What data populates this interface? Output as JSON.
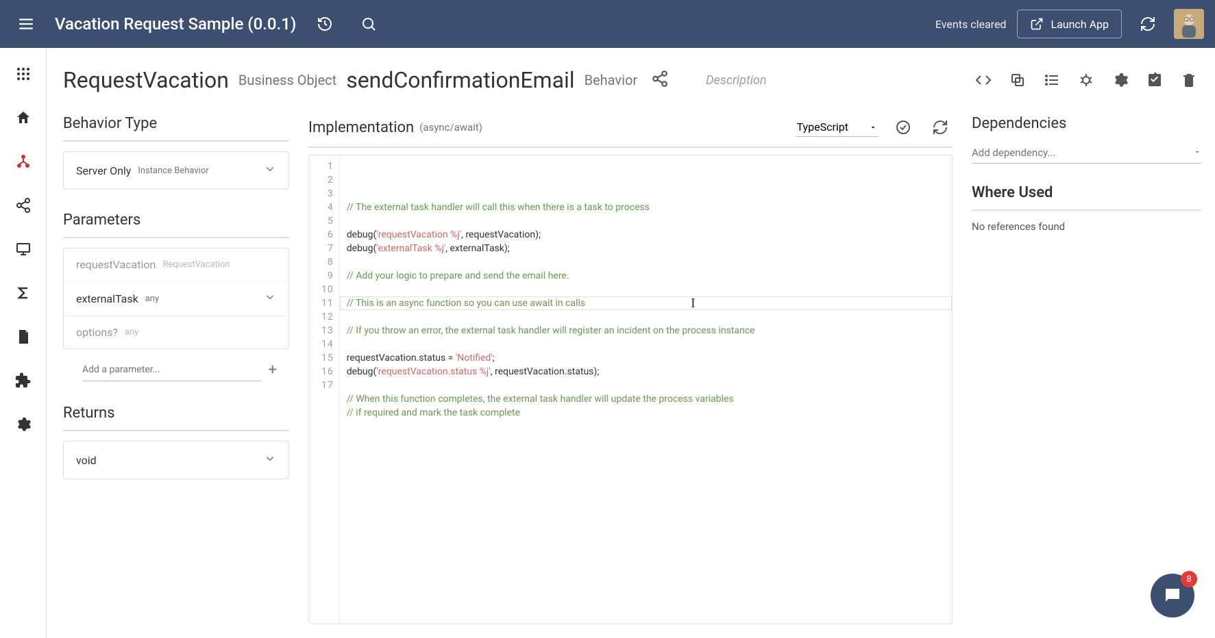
{
  "app": {
    "title": "Vacation Request Sample (0.0.1)",
    "events": "Events cleared",
    "launch": "Launch App"
  },
  "breadcrumb": {
    "entity": "RequestVacation",
    "entityType": "Business Object",
    "behavior": "sendConfirmationEmail",
    "behaviorType": "Behavior",
    "description": "Description"
  },
  "left": {
    "behaviorTypeTitle": "Behavior Type",
    "behaviorType": "Server Only",
    "behaviorTypeSub": "Instance Behavior",
    "parametersTitle": "Parameters",
    "params": [
      {
        "name": "requestVacation",
        "type": "RequestVacation",
        "dim": true,
        "expandable": false
      },
      {
        "name": "externalTask",
        "type": "any",
        "dim": false,
        "expandable": true
      },
      {
        "name": "options?",
        "type": "any",
        "dim": true,
        "expandable": false
      }
    ],
    "addParam": "Add a parameter...",
    "returnsTitle": "Returns",
    "returnsValue": "void"
  },
  "editor": {
    "title": "Implementation",
    "subtitle": "(async/await)",
    "language": "TypeScript",
    "lines": [
      {
        "n": 1,
        "plain": "// The external task handler will call this when there is a task to process",
        "cls": "c"
      },
      {
        "n": 2,
        "plain": "",
        "cls": ""
      },
      {
        "n": 3,
        "pre": "debug(",
        "str": "'requestVacation %j'",
        "post": ", requestVacation);"
      },
      {
        "n": 4,
        "pre": "debug(",
        "str": "'externalTask %j'",
        "post": ", externalTask);"
      },
      {
        "n": 5,
        "plain": "",
        "cls": ""
      },
      {
        "n": 6,
        "plain": "// Add your logic to prepare and send the email here.",
        "cls": "c"
      },
      {
        "n": 7,
        "plain": "",
        "cls": ""
      },
      {
        "n": 8,
        "plain": "// This is an async function so you can use await in calls",
        "cls": "c"
      },
      {
        "n": 9,
        "plain": "",
        "cls": ""
      },
      {
        "n": 10,
        "plain": "// If you throw an error, the external task handler will register an incident on the process instance",
        "cls": "c"
      },
      {
        "n": 11,
        "plain": "",
        "cls": ""
      },
      {
        "n": 12,
        "pre": "requestVacation.status = ",
        "str": "'Notified'",
        "post": ";"
      },
      {
        "n": 13,
        "pre": "debug(",
        "str": "'requestVacation.status %j'",
        "post": ", requestVacation.status);"
      },
      {
        "n": 14,
        "plain": "",
        "cls": ""
      },
      {
        "n": 15,
        "plain": "// When this function completes, the external task handler will update the process variables",
        "cls": "c"
      },
      {
        "n": 16,
        "plain": "// if required and mark the task complete",
        "cls": "c"
      },
      {
        "n": 17,
        "plain": "",
        "cls": ""
      }
    ]
  },
  "right": {
    "depTitle": "Dependencies",
    "depPlaceholder": "Add dependency...",
    "whereTitle": "Where Used",
    "noRef": "No references found"
  },
  "chat": {
    "badge": "8"
  }
}
